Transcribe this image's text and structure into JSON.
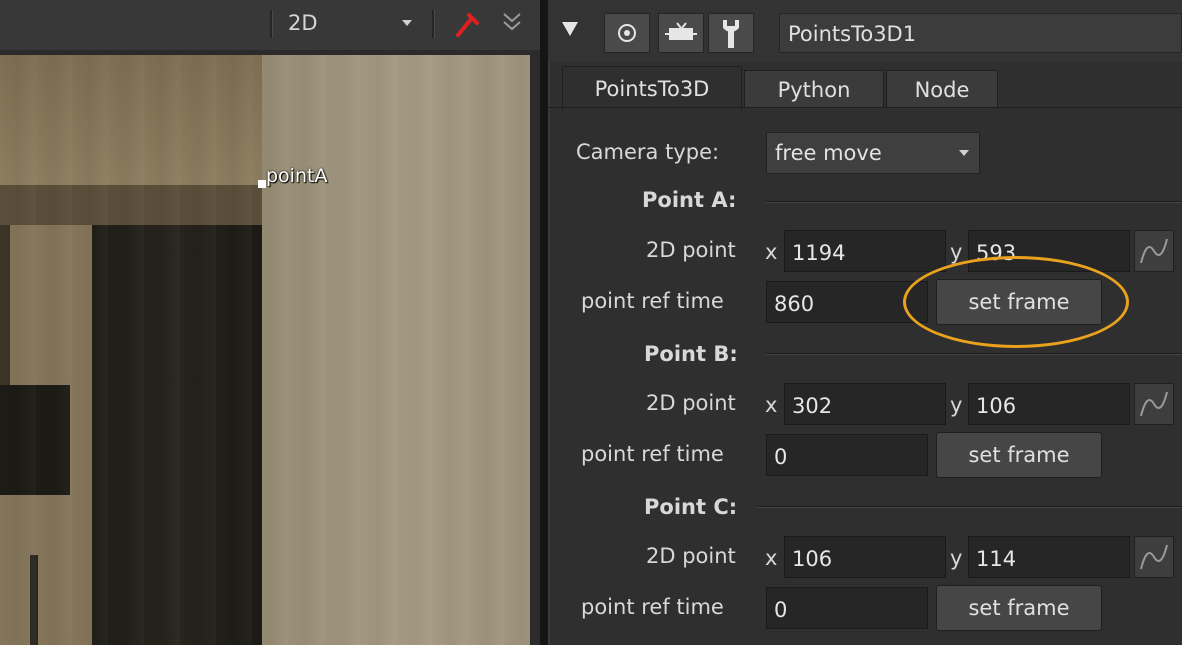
{
  "viewer": {
    "view_mode": "2D",
    "point_label": "pointA"
  },
  "panel": {
    "node_name": "PointsTo3D1",
    "tabs": [
      {
        "label": "PointsTo3D"
      },
      {
        "label": "Python"
      },
      {
        "label": "Node"
      }
    ],
    "camera_type_label": "Camera type:",
    "camera_type_value": "free move",
    "labels": {
      "point_2d": "2D point",
      "x": "x",
      "y": "y",
      "ref_time": "point ref time",
      "set_frame": "set frame"
    },
    "points": [
      {
        "title": "Point A:",
        "x": "1194",
        "y": "593",
        "ref_time": "860"
      },
      {
        "title": "Point B:",
        "x": "302",
        "y": "106",
        "ref_time": "0"
      },
      {
        "title": "Point C:",
        "x": "106",
        "y": "114",
        "ref_time": "0"
      }
    ]
  },
  "colors": {
    "highlight": "#e8a21e",
    "pin_red": "#e02020"
  }
}
